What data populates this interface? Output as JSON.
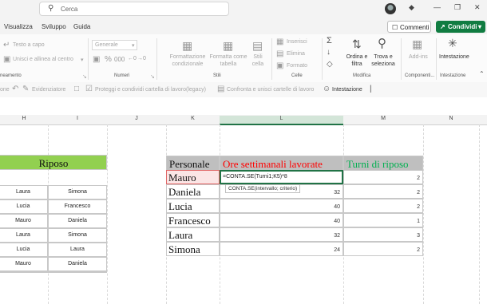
{
  "titlebar": {
    "search_placeholder": "Cerca"
  },
  "menu": {
    "view": "Visualizza",
    "dev": "Sviluppo",
    "help": "Guida",
    "comments": "Commenti",
    "share": "Condividi"
  },
  "ribbon": {
    "wrap_text": "Testo a capo",
    "merge_center": "Unisci e allinea al centro",
    "group_alignment": "neamento",
    "number_format": "Generale",
    "group_numbers": "Numeri",
    "cond_format": "Formattazione condizionale",
    "format_table": "Formatta come tabella",
    "cell_styles": "Stili cella",
    "group_styles": "Stili",
    "insert": "Inserisci",
    "delete": "Elimina",
    "format": "Formato",
    "group_cells": "Celle",
    "sort_filter": "Ordina e filtra",
    "find_select": "Trova e seleziona",
    "group_edit": "Modifica",
    "addins": "Add-ins",
    "group_addins": "Componenti...",
    "header": "Intestazione",
    "group_header": "Intestazione"
  },
  "toolbar2": {
    "one": "one",
    "highlighter": "Evidenziatore",
    "protect_share": "Proteggi e condividi cartella di lavoro(legacy)",
    "compare_merge": "Confronta e unisci cartelle di lavoro",
    "header": "Intestazione"
  },
  "columns": [
    "H",
    "I",
    "J",
    "K",
    "L",
    "M",
    "N"
  ],
  "riposo": {
    "title": "Riposo",
    "rows": [
      [
        "Laura",
        "Simona"
      ],
      [
        "Lucia",
        "Francesco"
      ],
      [
        "Mauro",
        "Daniela"
      ],
      [
        "Laura",
        "Simona"
      ],
      [
        "Lucia",
        "Laura"
      ],
      [
        "Mauro",
        "Daniela"
      ]
    ]
  },
  "table": {
    "headers": [
      "Personale",
      "Ore settimanali lavorate",
      "Turni di riposo"
    ],
    "rows": [
      {
        "name": "Mauro",
        "hours": "",
        "turni": "2"
      },
      {
        "name": "Daniela",
        "hours": "32",
        "turni": "2"
      },
      {
        "name": "Lucia",
        "hours": "40",
        "turni": "2"
      },
      {
        "name": "Francesco",
        "hours": "40",
        "turni": "1"
      },
      {
        "name": "Laura",
        "hours": "32",
        "turni": "3"
      },
      {
        "name": "Simona",
        "hours": "24",
        "turni": "2"
      }
    ],
    "formula": "=CONTA.SE(Turni1;K5)*8",
    "tooltip": "CONTA.SE(intervallo; criterio)"
  },
  "colors": {
    "green_header": "#92d050",
    "red_text": "#ff0000",
    "green_text": "#00b050",
    "pink_cell": "#fbe5e5",
    "accent": "#107c41"
  }
}
